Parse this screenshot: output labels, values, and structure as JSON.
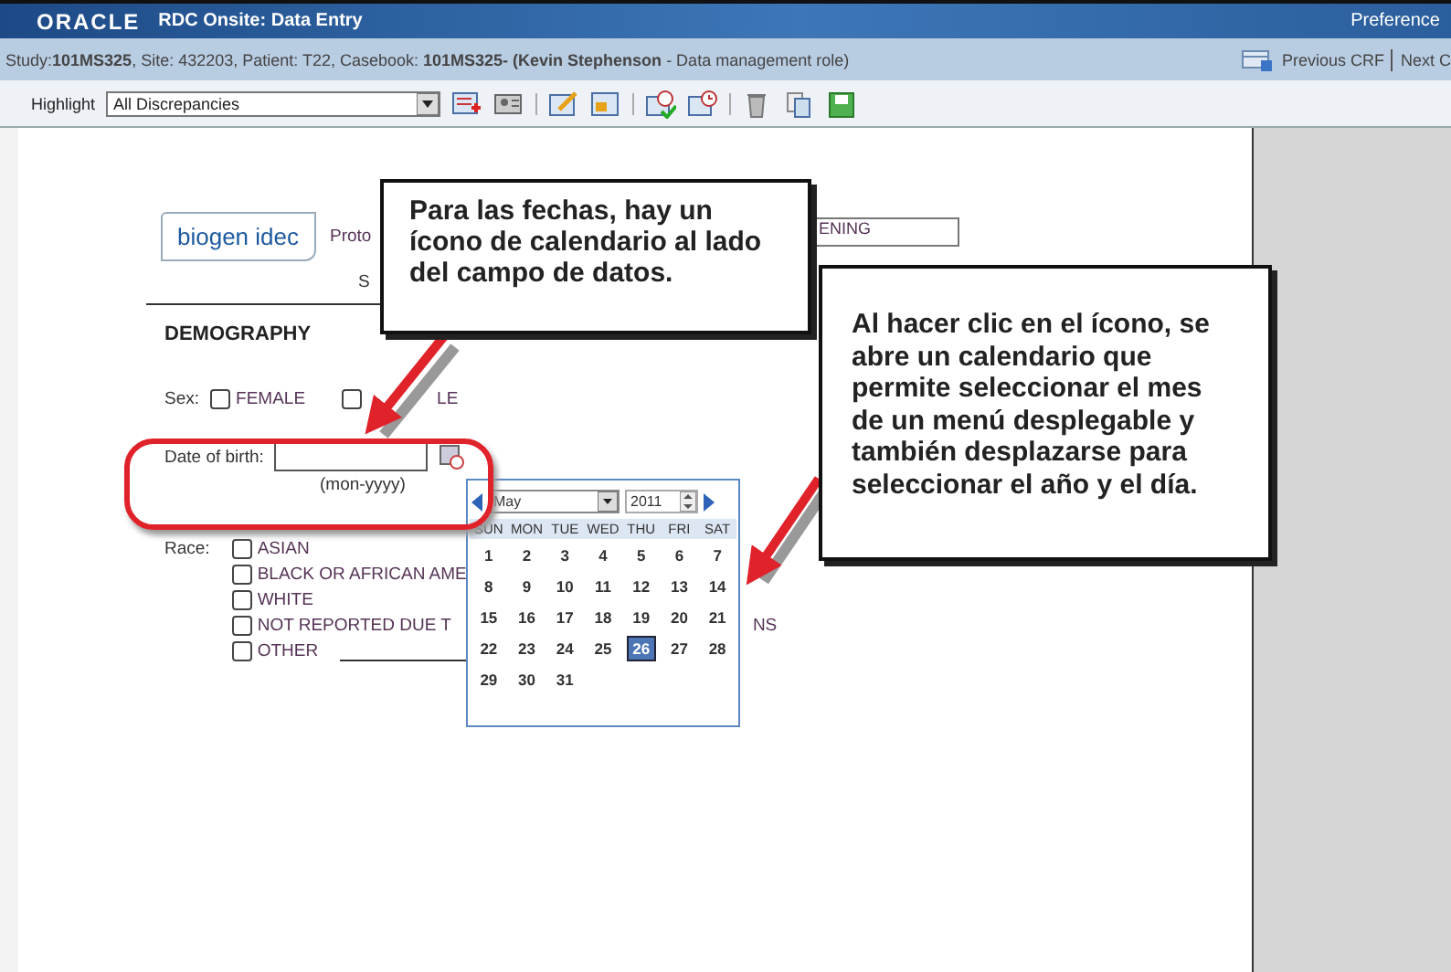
{
  "window": {
    "logo": "ORACLE",
    "title": "RDC Onsite: Data Entry",
    "link": "Preference"
  },
  "context_bar": {
    "text": "Study:**101MS325**, Site: 432203, Patient: T22, Casebook: **101MS325- (Kevin Stephenson** - Data management role)",
    "previous": "Previous CRF",
    "next": "Next C"
  },
  "toolbar": {
    "label": "Highlight",
    "value": "All Discrepancies"
  },
  "form": {
    "logo": "biogen idec",
    "protocol_label": "Proto",
    "subject_label": "S",
    "visit_field": "ENING",
    "section": "DEMOGRAPHY",
    "sex": {
      "label": "Sex:",
      "options": [
        {
          "label": "FEMALE",
          "checked": false
        },
        {
          "label": "LE",
          "checked": false
        }
      ]
    },
    "date_of_birth": {
      "label": "Date of birth:",
      "hint": "(mon-yyyy)"
    },
    "race": {
      "label": "Race:",
      "options": [
        {
          "label": "ASIAN",
          "checked": false
        },
        {
          "label": "BLACK OR AFRICAN AME",
          "checked": false
        },
        {
          "label": "WHITE",
          "checked": false
        },
        {
          "label": "NOT REPORTED DUE T",
          "checked": false,
          "trailing": "NS"
        },
        {
          "label": "OTHER",
          "checked": false,
          "specify_line": true
        }
      ]
    }
  },
  "calendar": {
    "month": "May",
    "year": "2011",
    "weekdays": [
      "SUN",
      "MON",
      "TUE",
      "WED",
      "THU",
      "FRI",
      "SAT"
    ],
    "days": [
      {
        "label": "1",
        "selected": false
      },
      {
        "label": "2",
        "selected": false
      },
      {
        "label": "3",
        "selected": false
      },
      {
        "label": "4",
        "selected": false
      },
      {
        "label": "5",
        "selected": false
      },
      {
        "label": "6",
        "selected": false
      },
      {
        "label": "7",
        "selected": false
      },
      {
        "label": "8",
        "selected": false
      },
      {
        "label": "9",
        "selected": false
      },
      {
        "label": "10",
        "selected": false
      },
      {
        "label": "11",
        "selected": false
      },
      {
        "label": "12",
        "selected": false
      },
      {
        "label": "13",
        "selected": false
      },
      {
        "label": "14",
        "selected": false
      },
      {
        "label": "15",
        "selected": false
      },
      {
        "label": "16",
        "selected": false
      },
      {
        "label": "17",
        "selected": false
      },
      {
        "label": "18",
        "selected": false
      },
      {
        "label": "19",
        "selected": false
      },
      {
        "label": "20",
        "selected": false
      },
      {
        "label": "21",
        "selected": false
      },
      {
        "label": "22",
        "selected": false
      },
      {
        "label": "23",
        "selected": false
      },
      {
        "label": "24",
        "selected": false
      },
      {
        "label": "25",
        "selected": false
      },
      {
        "label": "26",
        "selected": true
      },
      {
        "label": "27",
        "selected": false
      },
      {
        "label": "28",
        "selected": false
      },
      {
        "label": "29",
        "selected": false
      },
      {
        "label": "30",
        "selected": false
      },
      {
        "label": "31",
        "selected": false
      }
    ]
  },
  "callouts": [
    "Para las fechas, hay un ícono de calendario al lado del campo de datos.",
    "Al hacer clic en el ícono, se abre un calendario que permite seleccionar el mes de un menú desplegable y también desplazarse para seleccionar el año y el día."
  ]
}
